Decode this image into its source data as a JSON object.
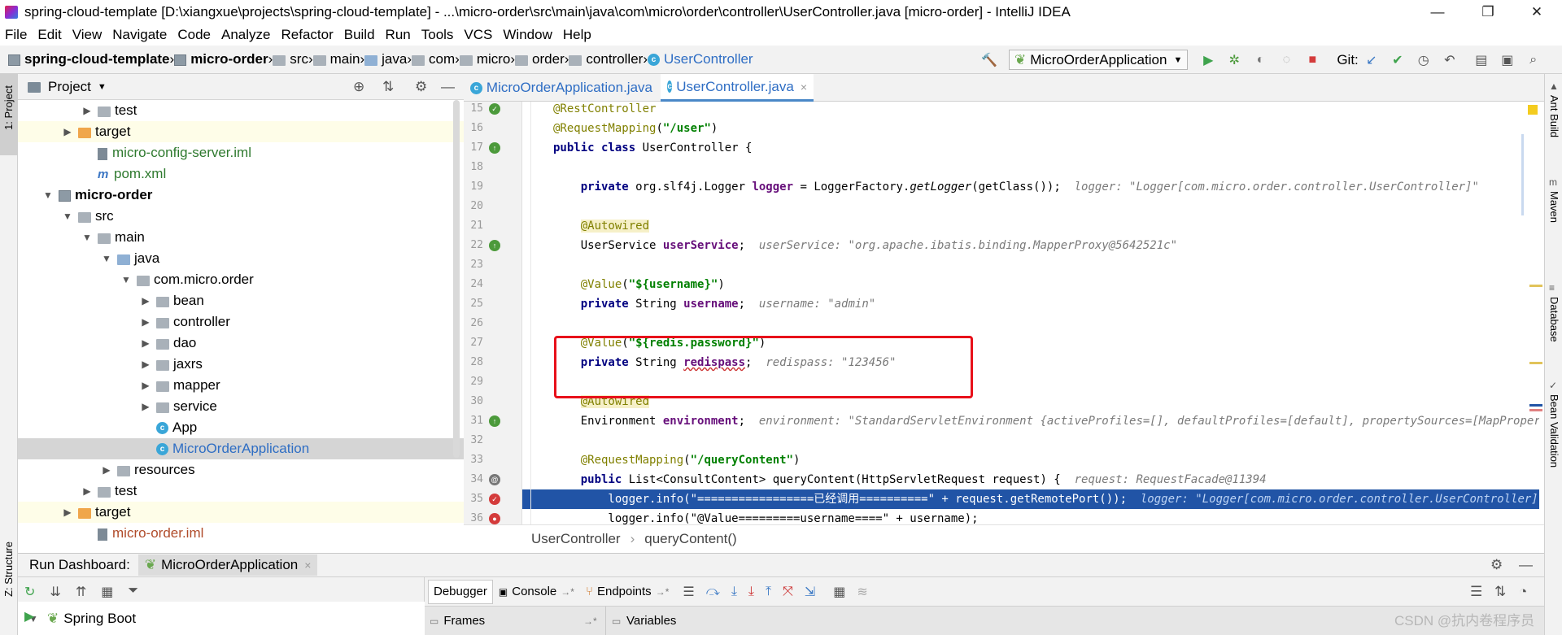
{
  "window": {
    "title": "spring-cloud-template [D:\\xiangxue\\projects\\spring-cloud-template] - ...\\micro-order\\src\\main\\java\\com\\micro\\order\\controller\\UserController.java [micro-order] - IntelliJ IDEA",
    "minimize": "—",
    "restore": "❐",
    "close": "✕"
  },
  "menu": [
    "File",
    "Edit",
    "View",
    "Navigate",
    "Code",
    "Analyze",
    "Refactor",
    "Build",
    "Run",
    "Tools",
    "VCS",
    "Window",
    "Help"
  ],
  "breadcrumb": [
    "spring-cloud-template",
    "micro-order",
    "src",
    "main",
    "java",
    "com",
    "micro",
    "order",
    "controller",
    "UserController"
  ],
  "toolbar": {
    "run_config": "MicroOrderApplication",
    "git_label": "Git:"
  },
  "left_toolwindows": {
    "project": "1: Project",
    "structure": "Z: Structure"
  },
  "right_toolwindows": [
    "Ant Build",
    "Maven",
    "Database",
    "Bean Validation"
  ],
  "project_panel": {
    "title": "Project"
  },
  "tree": [
    {
      "label": "test",
      "depth": 3,
      "arrow": "▶",
      "icon": "folder-grey",
      "hl": false
    },
    {
      "label": "target",
      "depth": 2,
      "arrow": "▶",
      "icon": "folder-orange",
      "hl": true
    },
    {
      "label": "micro-config-server.iml",
      "depth": 3,
      "arrow": "",
      "icon": "module-file",
      "color": "#2f7a2f",
      "hl": false
    },
    {
      "label": "pom.xml",
      "depth": 3,
      "arrow": "",
      "icon": "maven",
      "color": "#2f7a2f",
      "hl": false
    },
    {
      "label": "micro-order",
      "depth": 1,
      "arrow": "▼",
      "icon": "module",
      "bold": true,
      "hl": false
    },
    {
      "label": "src",
      "depth": 2,
      "arrow": "▼",
      "icon": "folder-grey",
      "hl": false
    },
    {
      "label": "main",
      "depth": 3,
      "arrow": "▼",
      "icon": "folder-grey",
      "hl": false
    },
    {
      "label": "java",
      "depth": 4,
      "arrow": "▼",
      "icon": "folder-blue",
      "hl": false
    },
    {
      "label": "com.micro.order",
      "depth": 5,
      "arrow": "▼",
      "icon": "folder-grey",
      "hl": false
    },
    {
      "label": "bean",
      "depth": 6,
      "arrow": "▶",
      "icon": "folder-grey",
      "hl": false
    },
    {
      "label": "controller",
      "depth": 6,
      "arrow": "▶",
      "icon": "folder-grey",
      "hl": false
    },
    {
      "label": "dao",
      "depth": 6,
      "arrow": "▶",
      "icon": "folder-grey",
      "hl": false
    },
    {
      "label": "jaxrs",
      "depth": 6,
      "arrow": "▶",
      "icon": "folder-grey",
      "hl": false
    },
    {
      "label": "mapper",
      "depth": 6,
      "arrow": "▶",
      "icon": "folder-grey",
      "hl": false
    },
    {
      "label": "service",
      "depth": 6,
      "arrow": "▶",
      "icon": "folder-grey",
      "hl": false
    },
    {
      "label": "App",
      "depth": 6,
      "arrow": "",
      "icon": "class",
      "hl": false
    },
    {
      "label": "MicroOrderApplication",
      "depth": 6,
      "arrow": "",
      "icon": "class",
      "color": "#2f6ec4",
      "sel": true
    },
    {
      "label": "resources",
      "depth": 4,
      "arrow": "▶",
      "icon": "folder-grey",
      "hl": false
    },
    {
      "label": "test",
      "depth": 3,
      "arrow": "▶",
      "icon": "folder-grey",
      "hl": false
    },
    {
      "label": "target",
      "depth": 2,
      "arrow": "▶",
      "icon": "folder-orange",
      "hl": true
    },
    {
      "label": "micro-order.iml",
      "depth": 3,
      "arrow": "",
      "icon": "module-file",
      "color": "#b04c2b",
      "hl": false
    }
  ],
  "editor_tabs": [
    {
      "label": "MicroOrderApplication.java",
      "active": false
    },
    {
      "label": "UserController.java",
      "active": true
    }
  ],
  "tab_close": "×",
  "code_lines": [
    {
      "num": "15",
      "html": "<span class=\"ann\">@RestController</span>"
    },
    {
      "num": "16",
      "html": "<span class=\"ann\">@RequestMapping</span>(<span class=\"str\">\"/user\"</span>)"
    },
    {
      "num": "17",
      "html": "<span class=\"kw\">public class</span> UserController {"
    },
    {
      "num": "18",
      "html": ""
    },
    {
      "num": "19",
      "html": "    <span class=\"kw\">private</span> org.slf4j.Logger <span class=\"fld\">logger</span> = LoggerFactory.<span class=\"ital\">getLogger</span>(getClass());  <span class=\"hint\">logger: \"Logger[com.micro.order.controller.UserController]\"</span>"
    },
    {
      "num": "20",
      "html": ""
    },
    {
      "num": "21",
      "html": "    <span class=\"ann2\">@Autowired</span>"
    },
    {
      "num": "22",
      "html": "    UserService <span class=\"fld\">userService</span>;  <span class=\"hint\">userService: \"org.apache.ibatis.binding.MapperProxy@5642521c\"</span>"
    },
    {
      "num": "23",
      "html": ""
    },
    {
      "num": "24",
      "html": "    <span class=\"ann\">@Value</span>(<span class=\"str\">\"${username}\"</span>)"
    },
    {
      "num": "25",
      "html": "    <span class=\"kw\">private</span> String <span class=\"fld\">username</span>;  <span class=\"hint\">username: \"admin\"</span>"
    },
    {
      "num": "26",
      "html": ""
    },
    {
      "num": "27",
      "html": "    <span class=\"ann\">@Value</span>(<span class=\"str\">\"${redis.password}\"</span>)"
    },
    {
      "num": "28",
      "html": "    <span class=\"kw\">private</span> String <span class=\"fld\" style=\"text-decoration:underline wavy #c33\">redispass</span>;  <span class=\"hint\">redispass: \"123456\"</span>"
    },
    {
      "num": "29",
      "html": ""
    },
    {
      "num": "30",
      "html": "    <span class=\"ann2\">@Autowired</span>"
    },
    {
      "num": "31",
      "html": "    Environment <span class=\"fld\">environment</span>;  <span class=\"hint\">environment: \"StandardServletEnvironment {activeProfiles=[], defaultProfiles=[default], propertySources=[MapPropertySource {name</span>"
    },
    {
      "num": "32",
      "html": ""
    },
    {
      "num": "33",
      "html": "    <span class=\"ann\">@RequestMapping</span>(<span class=\"str\">\"/queryContent\"</span>)"
    },
    {
      "num": "34",
      "html": "    <span class=\"kw\">public</span> List&lt;ConsultContent&gt; queryContent(HttpServletRequest request) {  <span class=\"hint\">request: RequestFacade@11394</span>"
    },
    {
      "num": "35",
      "html": "        logger.info(\"=================已经调用==========\" + request.getRemotePort());  <span class=\"hint-w\">logger: \"Logger[com.micro.order.controller.UserController]\"  request</span>",
      "exec": true
    },
    {
      "num": "36",
      "html": "        logger.info(\"@Value=========username====\" + username);"
    }
  ],
  "editor_breadcrumb": [
    "UserController",
    "queryContent()"
  ],
  "run_dashboard": {
    "label": "Run Dashboard:",
    "config": "MicroOrderApplication",
    "tree_root": "Spring Boot"
  },
  "debug_tabs": [
    "Debugger",
    "Console",
    "Endpoints"
  ],
  "debug_panels": {
    "frames": "Frames",
    "variables": "Variables"
  },
  "watermark": "CSDN @抗内卷程序员",
  "colors": {
    "accent": "#2f6ec4",
    "exec_line": "#2154a6",
    "highlight_box": "#e8101a"
  }
}
